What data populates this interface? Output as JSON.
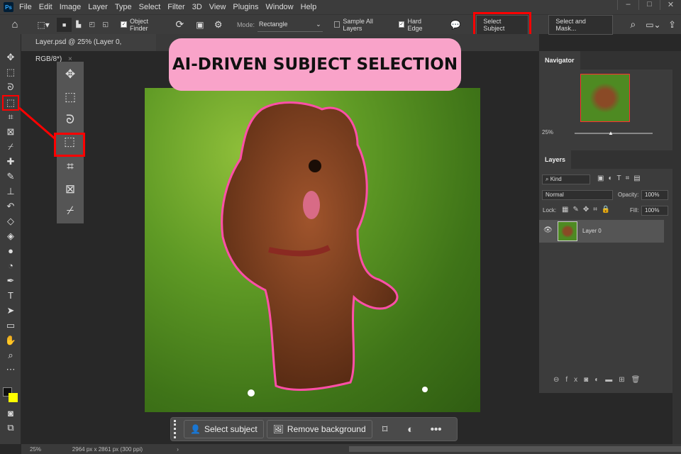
{
  "app": {
    "logo": "Ps",
    "menu": [
      "File",
      "Edit",
      "Image",
      "Layer",
      "Type",
      "Select",
      "Filter",
      "3D",
      "View",
      "Plugins",
      "Window",
      "Help"
    ],
    "window_controls": [
      "minimize-icon",
      "maximize-icon",
      "close-icon"
    ]
  },
  "options": {
    "object_finder": "Object Finder",
    "mode_label": "Mode:",
    "mode_value": "Rectangle",
    "sample_all_layers": "Sample All Layers",
    "hard_edge": "Hard Edge",
    "select_subject": "Select Subject",
    "select_and_mask": "Select and Mask..."
  },
  "document_tab": {
    "title": "Layer.psd @ 25% (Layer 0, RGB/8*)",
    "close": "×"
  },
  "banner": {
    "text": "AI-DRIVEN SUBJECT SELECTION"
  },
  "navigator": {
    "title": "Navigator",
    "zoom": "25%"
  },
  "layers": {
    "title": "Layers",
    "filter": "Kind",
    "blend_mode": "Normal",
    "opacity_label": "Opacity:",
    "opacity": "100%",
    "lock_label": "Lock:",
    "fill_label": "Fill:",
    "fill": "100%",
    "items": [
      {
        "name": "Layer 0",
        "visible": true
      }
    ],
    "fx": "fx"
  },
  "context_bar": {
    "select_subject": "Select subject",
    "remove_background": "Remove background"
  },
  "status": {
    "zoom": "25%",
    "doc_info": "2964 px x 2861 px (300 ppi)"
  },
  "colors": {
    "highlight": "#ff0000",
    "banner": "#f9a3c9",
    "selection": "#ff4fa8"
  }
}
